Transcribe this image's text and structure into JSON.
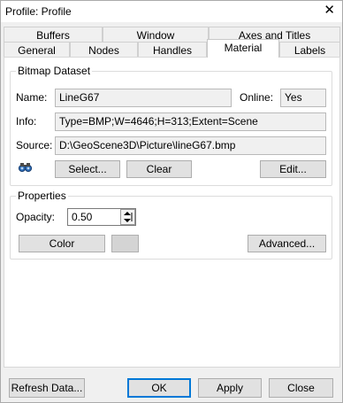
{
  "window": {
    "title": "Profile: Profile",
    "close_glyph": "✕"
  },
  "tabs_row1": [
    "Buffers",
    "Window",
    "Axes and Titles"
  ],
  "tabs_row2": [
    "General",
    "Nodes",
    "Handles",
    "Material",
    "Labels"
  ],
  "active_tab": "Material",
  "bitmap": {
    "group_title": "Bitmap Dataset",
    "name_label": "Name:",
    "name_value": "LineG67",
    "online_label": "Online:",
    "online_value": "Yes",
    "info_label": "Info:",
    "info_value": "Type=BMP;W=4646;H=313;Extent=Scene",
    "source_label": "Source:",
    "source_value": "D:\\GeoScene3D\\Picture\\lineG67.bmp",
    "icon": "binoculars-icon",
    "select_label": "Select...",
    "clear_label": "Clear",
    "edit_label": "Edit..."
  },
  "properties": {
    "group_title": "Properties",
    "opacity_label": "Opacity:",
    "opacity_value": "0.50",
    "color_label": "Color",
    "advanced_label": "Advanced..."
  },
  "footer": {
    "refresh_label": "Refresh Data...",
    "ok_label": "OK",
    "apply_label": "Apply",
    "close_label": "Close"
  },
  "colors": {
    "accent": "#0078d7",
    "swatch": "#d4d4d4"
  }
}
